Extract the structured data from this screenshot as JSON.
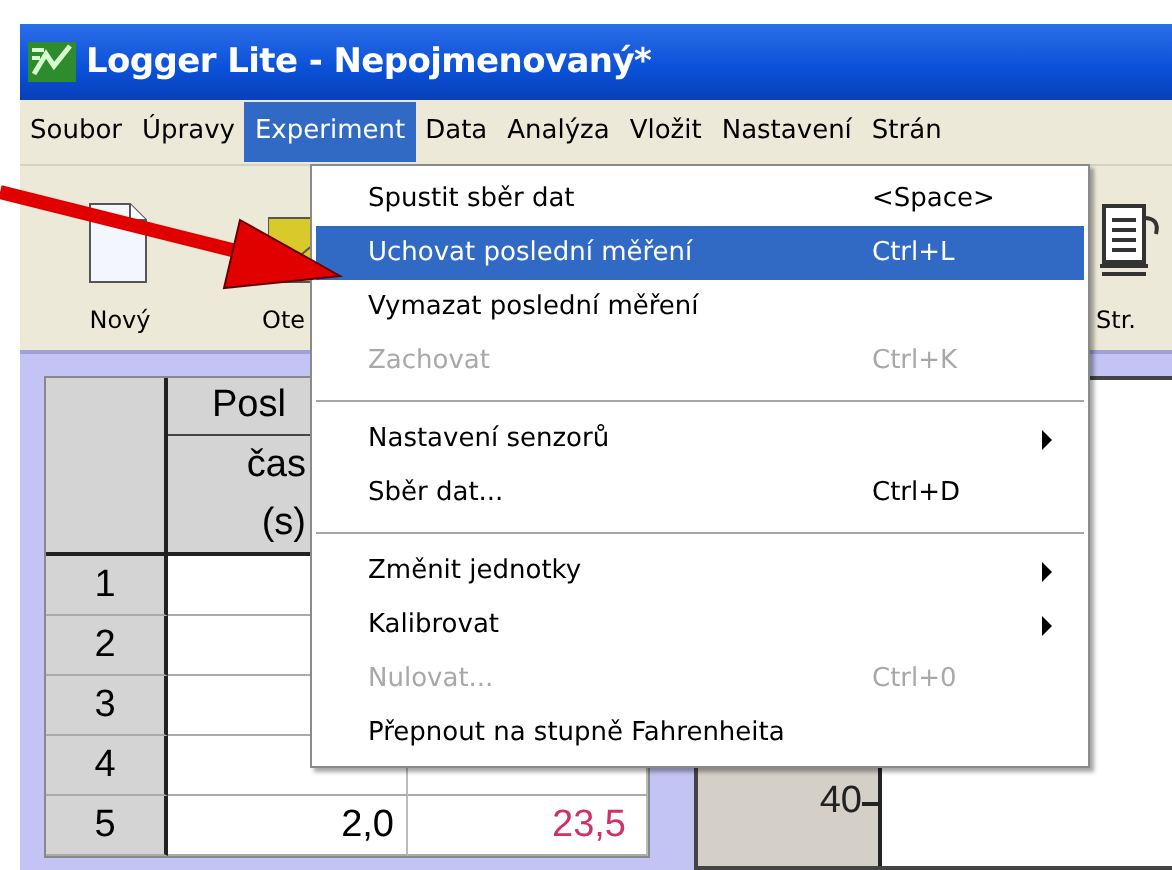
{
  "window": {
    "title": "Logger Lite - Nepojmenovaný*"
  },
  "menubar": [
    {
      "label": "Soubor",
      "selected": false
    },
    {
      "label": "Úpravy",
      "selected": false
    },
    {
      "label": "Experiment",
      "selected": true
    },
    {
      "label": "Data",
      "selected": false
    },
    {
      "label": "Analýza",
      "selected": false
    },
    {
      "label": "Vložit",
      "selected": false
    },
    {
      "label": "Nastavení",
      "selected": false
    },
    {
      "label": "Strán",
      "selected": false
    }
  ],
  "toolbar": [
    {
      "kind": "new",
      "label": "Nový"
    },
    {
      "kind": "open",
      "label": "Ote"
    },
    {
      "kind": "page",
      "label": "Str."
    }
  ],
  "menu": [
    {
      "kind": "item",
      "label": "Spustit sběr dat",
      "shortcut": "<Space>",
      "selected": false,
      "disabled": false,
      "submenu": false
    },
    {
      "kind": "item",
      "label": "Uchovat poslední měření",
      "shortcut": "Ctrl+L",
      "selected": true,
      "disabled": false,
      "submenu": false
    },
    {
      "kind": "item",
      "label": "Vymazat poslední měření",
      "selected": false,
      "disabled": false,
      "submenu": false
    },
    {
      "kind": "item",
      "label": "Zachovat",
      "shortcut": "Ctrl+K",
      "selected": false,
      "disabled": true,
      "submenu": false
    },
    {
      "kind": "separator"
    },
    {
      "kind": "item",
      "label": "Nastavení senzorů",
      "selected": false,
      "disabled": false,
      "submenu": true
    },
    {
      "kind": "item",
      "label": "Sběr dat...",
      "shortcut": "Ctrl+D",
      "selected": false,
      "disabled": false,
      "submenu": false
    },
    {
      "kind": "separator"
    },
    {
      "kind": "item",
      "label": "Změnit jednotky",
      "selected": false,
      "disabled": false,
      "submenu": true
    },
    {
      "kind": "item",
      "label": "Kalibrovat",
      "selected": false,
      "disabled": false,
      "submenu": true
    },
    {
      "kind": "item",
      "label": "Nulovat...",
      "shortcut": "Ctrl+0",
      "selected": false,
      "disabled": true,
      "submenu": false
    },
    {
      "kind": "item",
      "label": "Přepnout na stupně Fahrenheita",
      "selected": false,
      "disabled": false,
      "submenu": false
    }
  ],
  "table": {
    "group_header": "Posl",
    "columns": [
      {
        "name": "čas",
        "unit": "(s)"
      }
    ],
    "rows": [
      {
        "index": "1"
      },
      {
        "index": "2"
      },
      {
        "index": "3"
      },
      {
        "index": "4"
      },
      {
        "index": "5",
        "cells": [
          "2,0",
          "23,5"
        ]
      }
    ]
  },
  "graph": {
    "tick_label": "40"
  }
}
